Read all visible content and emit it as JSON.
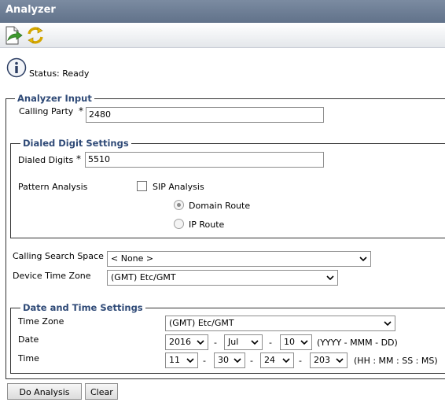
{
  "window": {
    "title": "Analyzer"
  },
  "toolbar": {
    "icons": [
      "execute-icon",
      "refresh-icon"
    ]
  },
  "status": {
    "text": "Status: Ready",
    "icon": "info-icon"
  },
  "analyzer_input": {
    "legend": "Analyzer Input",
    "calling_party_label": "Calling Party",
    "required_mark": "*",
    "calling_party_value": "2480"
  },
  "dialed_digit_settings": {
    "legend": "Dialed Digit Settings",
    "dialed_digits_label": "Dialed Digits",
    "required_mark": "*",
    "dialed_digits_value": "5510",
    "pattern_analysis_label": "Pattern Analysis",
    "sip_analysis_label": "SIP Analysis",
    "sip_analysis_checked": false,
    "domain_route_label": "Domain Route",
    "domain_route_selected": true,
    "ip_route_label": "IP Route",
    "ip_route_selected": false
  },
  "calling_search_space": {
    "label": "Calling Search Space",
    "value": "< None >"
  },
  "device_time_zone": {
    "label": "Device Time Zone",
    "value": "(GMT) Etc/GMT"
  },
  "date_time_settings": {
    "legend": "Date and Time Settings",
    "time_zone_label": "Time Zone",
    "time_zone_value": "(GMT) Etc/GMT",
    "date_label": "Date",
    "year": "2016",
    "month": "Jul",
    "day": "10",
    "date_sep": "-",
    "date_format": "(YYYY - MMM - DD)",
    "time_label": "Time",
    "hour": "11",
    "minute": "30",
    "second": "24",
    "millisecond": "203",
    "time_sep": "-",
    "time_format": "(HH : MM : SS : MS)"
  },
  "buttons": {
    "do_analysis": "Do Analysis",
    "clear": "Clear"
  },
  "colors": {
    "title_bar": "#6b7b92",
    "legend_text": "#2f4a77"
  }
}
